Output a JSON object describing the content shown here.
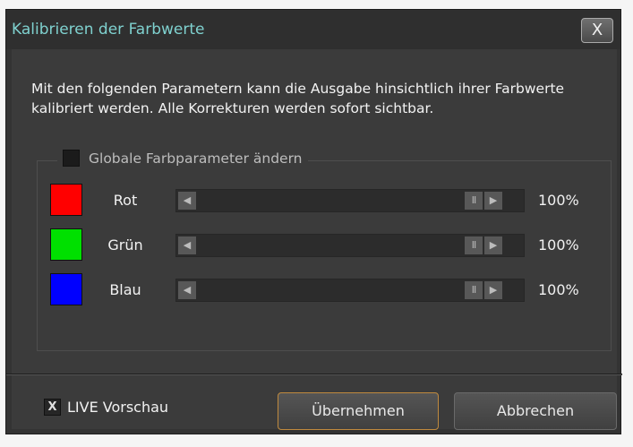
{
  "window": {
    "title": "Kalibrieren der Farbwerte",
    "close_label": "X"
  },
  "description": "Mit den folgenden Parametern kann die Ausgabe hinsichtlich ihrer Farbwerte kalibriert werden. Alle Korrekturen werden sofort sichtbar.",
  "global_params": {
    "label": "Globale Farbparameter ändern",
    "checked": false
  },
  "channels": [
    {
      "label": "Rot",
      "color": "#ff0000",
      "value": "100%"
    },
    {
      "label": "Grün",
      "color": "#00e000",
      "value": "100%"
    },
    {
      "label": "Blau",
      "color": "#0000ff",
      "value": "100%"
    }
  ],
  "slider_icons": {
    "left": "◀",
    "thumb": "II",
    "right": "▶"
  },
  "live_preview": {
    "label": "LIVE Vorschau",
    "checked": true,
    "mark": "X"
  },
  "buttons": {
    "apply": "Übernehmen",
    "cancel": "Abbrechen"
  },
  "colors": {
    "title_text": "#7fd1cf",
    "apply_border": "#c08a3e",
    "background": "#3b3b3b"
  }
}
